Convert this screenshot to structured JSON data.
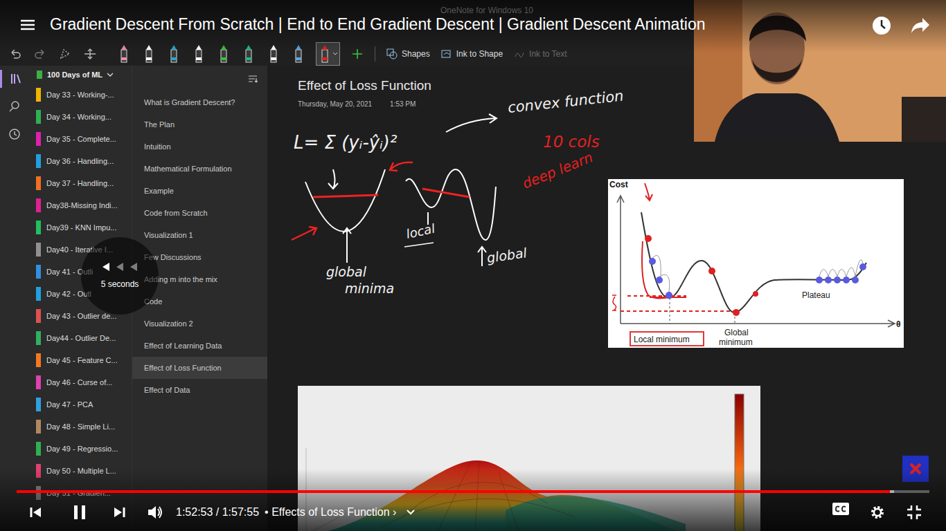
{
  "video": {
    "title": "Gradient Descent From Scratch | End to End Gradient Descent | Gradient Descent Animation",
    "seek_label": "5 seconds",
    "time": "1:52:53 / 1:57:55",
    "chapter": "• Effects of Loss Function ›",
    "progress": {
      "level": 0.957,
      "buffered": 0.961
    },
    "playing": true,
    "captions_on": false
  },
  "app": {
    "title": "OneNote for Windows 10",
    "pens": [
      {
        "color": "#f08cb4",
        "selected": false
      },
      {
        "color": "#ffffff",
        "selected": false
      },
      {
        "color": "#2aa8c8",
        "selected": false
      },
      {
        "color": "#ffffff",
        "selected": false
      },
      {
        "color": "#36c536",
        "selected": false
      },
      {
        "color": "#22b884",
        "selected": false
      },
      {
        "color": "#ffffff",
        "selected": false
      },
      {
        "color": "#5aa6e6",
        "selected": false
      },
      {
        "color": "#e02424",
        "selected": true
      }
    ],
    "tools": [
      {
        "label": "Shapes",
        "kind": "shapes",
        "disabled": false
      },
      {
        "label": "Ink to Shape",
        "kind": "ink-to-shape",
        "disabled": false
      },
      {
        "label": "Ink to Text",
        "kind": "ink-to-text",
        "disabled": true
      }
    ]
  },
  "notebook": {
    "name": "100 Days of ML"
  },
  "sections": [
    {
      "name": "Day 33 - Working-...",
      "color": "#f0b400"
    },
    {
      "name": "Day 34 - Working...",
      "color": "#30b050"
    },
    {
      "name": "Day 35 - Complete...",
      "color": "#e020b0"
    },
    {
      "name": "Day 36 - Handling...",
      "color": "#20a0e0"
    },
    {
      "name": "Day 37 - Handling...",
      "color": "#f07020"
    },
    {
      "name": "Day38-Missing Indi...",
      "color": "#e02090"
    },
    {
      "name": "Day39 - KNN Impu...",
      "color": "#20c060"
    },
    {
      "name": "Day40 - Iterative I...",
      "color": "#909090"
    },
    {
      "name": "Day 41 - Outli",
      "color": "#3090e0"
    },
    {
      "name": "Day 42 - Outl",
      "color": "#20a0e0"
    },
    {
      "name": "Day 43 - Outlier de...",
      "color": "#e05050"
    },
    {
      "name": "Day44 - Outlier De...",
      "color": "#30b060"
    },
    {
      "name": "Day 45 - Feature C...",
      "color": "#f07a20"
    },
    {
      "name": "Day 46 - Curse of...",
      "color": "#e040b0"
    },
    {
      "name": "Day 47 - PCA",
      "color": "#30a0e0"
    },
    {
      "name": "Day 48 - Simple Li...",
      "color": "#b08860"
    },
    {
      "name": "Day 49 - Regressio...",
      "color": "#30b050"
    },
    {
      "name": "Day 50 - Multiple L...",
      "color": "#e04070"
    },
    {
      "name": "Day 51 - Gradien...",
      "color": "#888888"
    }
  ],
  "pages": [
    {
      "title": "What is Gradient Descent?",
      "selected": false
    },
    {
      "title": "The Plan",
      "selected": false
    },
    {
      "title": "Intuition",
      "selected": false
    },
    {
      "title": "Mathematical Formulation",
      "selected": false
    },
    {
      "title": "Example",
      "selected": false
    },
    {
      "title": "Code from Scratch",
      "selected": false
    },
    {
      "title": "Visualization 1",
      "selected": false
    },
    {
      "title": "Few Discussions",
      "selected": false
    },
    {
      "title": "Adding m into the mix",
      "selected": false
    },
    {
      "title": "Code",
      "selected": false
    },
    {
      "title": "Visualization 2",
      "selected": false
    },
    {
      "title": "Effect of Learning Data",
      "selected": false
    },
    {
      "title": "Effect of Loss Function",
      "selected": true
    },
    {
      "title": "Effect of Data",
      "selected": false
    }
  ],
  "page": {
    "title": "Effect of Loss Function",
    "date": "Thursday, May 20, 2021",
    "time": "1:53 PM",
    "ink": {
      "formula": "L= Σ (yᵢ-ŷᵢ)²",
      "note": "convex function",
      "red_note_1": "10 cols",
      "red_note_2": "deep learn",
      "local": "local",
      "global_minima": [
        "global",
        "minima"
      ],
      "global": "global"
    },
    "figure": {
      "y_label": "Cost",
      "x_label": "θ",
      "plateau": "Plateau",
      "local": "Local minimum",
      "global": [
        "Global",
        "minimum"
      ]
    }
  }
}
